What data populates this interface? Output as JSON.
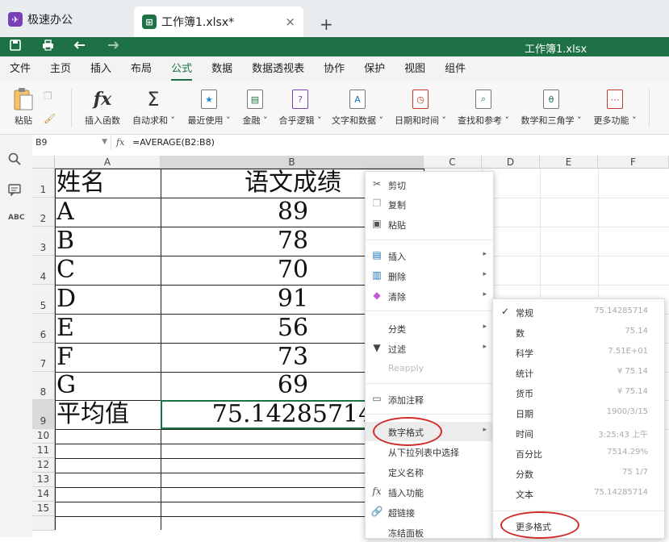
{
  "tabs": {
    "home_label": "极速办公",
    "doc_label": "工作簿1.xlsx*",
    "add_label": "+",
    "close_label": "×"
  },
  "window_title": "工作簿1.xlsx",
  "menus": [
    "文件",
    "主页",
    "插入",
    "布局",
    "公式",
    "数据",
    "数据透视表",
    "协作",
    "保护",
    "视图",
    "组件"
  ],
  "active_menu": "公式",
  "ribbon": {
    "paste": "粘贴",
    "insert_function": "插入函数",
    "autosum": "自动求和",
    "recent": "最近使用",
    "financial": "金融",
    "logical": "合乎逻辑",
    "text_data": "文字和数据",
    "date_time": "日期和时间",
    "lookup": "查找和参考",
    "math": "数学和三角学",
    "more": "更多功能"
  },
  "formula_bar": {
    "name_box": "B9",
    "fx": "fx",
    "formula": "=AVERAGE(B2:B8)"
  },
  "columns": [
    "A",
    "B",
    "C",
    "D",
    "E",
    "F"
  ],
  "rows": [
    "1",
    "2",
    "3",
    "4",
    "5",
    "6",
    "7",
    "8",
    "9",
    "10",
    "11",
    "12",
    "13",
    "14",
    "15"
  ],
  "table": {
    "header": [
      "姓名",
      "语文成绩"
    ],
    "data": [
      [
        "A",
        "89"
      ],
      [
        "B",
        "78"
      ],
      [
        "C",
        "70"
      ],
      [
        "D",
        "91"
      ],
      [
        "E",
        "56"
      ],
      [
        "F",
        "73"
      ],
      [
        "G",
        "69"
      ]
    ],
    "avg_label": "平均值",
    "avg_value": "75.14285714"
  },
  "context_menu": {
    "cut": "剪切",
    "copy": "复制",
    "paste": "粘贴",
    "insert": "插入",
    "delete": "删除",
    "clear": "清除",
    "sort": "分类",
    "filter": "过滤",
    "reapply": "Reapply",
    "add_comment": "添加注释",
    "number_format": "数字格式",
    "pick_from_list": "从下拉列表中选择",
    "define_name": "定义名称",
    "insert_function": "插入功能",
    "hyperlink": "超链接",
    "freeze_panes": "冻结面板"
  },
  "submenu": {
    "items": [
      {
        "label": "常规",
        "value": "75.14285714",
        "checked": "✓"
      },
      {
        "label": "数",
        "value": "75.14",
        "checked": ""
      },
      {
        "label": "科学",
        "value": "7.51E+01",
        "checked": ""
      },
      {
        "label": "统计",
        "value": "¥ 75.14",
        "checked": ""
      },
      {
        "label": "货币",
        "value": "¥ 75.14",
        "checked": ""
      },
      {
        "label": "日期",
        "value": "1900/3/15",
        "checked": ""
      },
      {
        "label": "时间",
        "value": "3:25:43 上午",
        "checked": ""
      },
      {
        "label": "百分比",
        "value": "7514.29%",
        "checked": ""
      },
      {
        "label": "分数",
        "value": "75 1/7",
        "checked": ""
      },
      {
        "label": "文本",
        "value": "75.14285714",
        "checked": ""
      }
    ],
    "more_formats": "更多格式"
  },
  "colors": {
    "brand_green": "#1e7145",
    "highlight_red": "#d02a2a"
  }
}
